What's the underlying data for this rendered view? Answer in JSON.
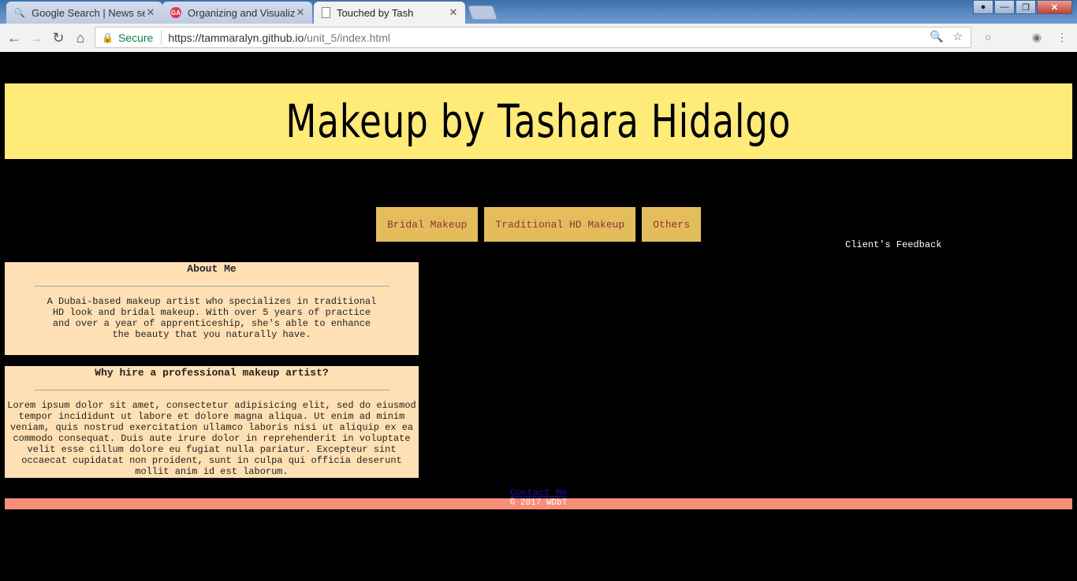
{
  "browser": {
    "tabs": [
      {
        "title": "Google Search | News se",
        "icon": "google-search-icon"
      },
      {
        "title": "Organizing and Visualizin",
        "icon": "ga-logo-icon"
      },
      {
        "title": "Touched by Tash",
        "icon": "page-icon"
      }
    ],
    "secure_label": "Secure",
    "url_host": "https://tammaralyn.github.io",
    "url_path": "/unit_5/index.html"
  },
  "page": {
    "title": "Makeup by Tashara Hidalgo",
    "nav": [
      "Bridal Makeup",
      "Traditional HD Makeup",
      "Others"
    ],
    "feedback_label": "Client's Feedback",
    "about": {
      "heading": "About Me",
      "body": "A Dubai-based makeup artist who specializes in traditional HD look and bridal makeup. With over 5 years of practice and over a year of apprenticeship, she's able to enhance the beauty that you naturally have."
    },
    "why": {
      "heading": "Why hire a professional makeup artist?",
      "body": "Lorem ipsum dolor sit amet, consectetur adipisicing elit, sed do eiusmod tempor incididunt ut labore et dolore magna aliqua. Ut enim ad minim veniam, quis nostrud exercitation ullamco laboris nisi ut aliquip ex ea commodo consequat. Duis aute irure dolor in reprehenderit in voluptate velit esse cillum dolore eu fugiat nulla pariatur. Excepteur sint occaecat cupidatat non proident, sunt in culpa qui officia deserunt mollit anim id est laborum."
    },
    "contact_label": "Contact Me",
    "footer": "© 2017 WDbT"
  },
  "colors": {
    "header_bg": "#ffeb77",
    "nav_bg": "#e3bd5b",
    "nav_text": "#8f3140",
    "card_bg": "#ffe0b5",
    "footer_bg": "#f98e78"
  }
}
